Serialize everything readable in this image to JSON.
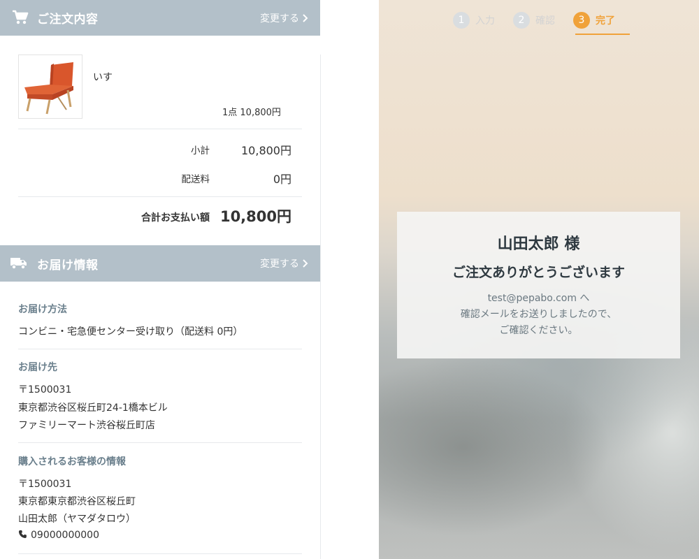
{
  "order_section": {
    "title": "ご注文内容",
    "change_label": "変更する",
    "product": {
      "name": "いす",
      "quantity_price": "1点   10,800円"
    },
    "subtotal_label": "小計",
    "subtotal_value": "10,800円",
    "shipping_label": "配送料",
    "shipping_value": "0円",
    "total_label": "合計お支払い額",
    "total_value": "10,800円"
  },
  "delivery_section": {
    "title": "お届け情報",
    "change_label": "変更する",
    "method_label": "お届け方法",
    "method_value": "コンビニ・宅急便センター受け取り（配送料 0円）",
    "destination_label": "お届け先",
    "destination_lines": [
      "〒1500031",
      "東京都渋谷区桜丘町24-1橋本ビル",
      "ファミリーマート渋谷桜丘町店"
    ],
    "customer_label": "購入されるお客様の情報",
    "customer_lines": [
      "〒1500031",
      "東京都東京都渋谷区桜丘町",
      "山田太郎（ヤマダタロウ）"
    ],
    "customer_phone": "09000000000"
  },
  "steps": [
    {
      "num": "1",
      "label": "入力",
      "active": false
    },
    {
      "num": "2",
      "label": "確認",
      "active": false
    },
    {
      "num": "3",
      "label": "完了",
      "active": true
    }
  ],
  "thanks": {
    "customer_name": "山田太郎 様",
    "message": "ご注文ありがとうございます",
    "email_line": "test@pepabo.com へ",
    "note_line1": "確認メールをお送りしましたので、",
    "note_line2": "ご確認ください。"
  },
  "colors": {
    "header_bg": "#b3c0c9",
    "accent": "#f0a23a",
    "label_color": "#6a7f8c"
  },
  "icons": {
    "order_header": "cart-icon",
    "delivery_header": "truck-icon",
    "change": "chevron-right-icon",
    "phone": "phone-icon"
  }
}
